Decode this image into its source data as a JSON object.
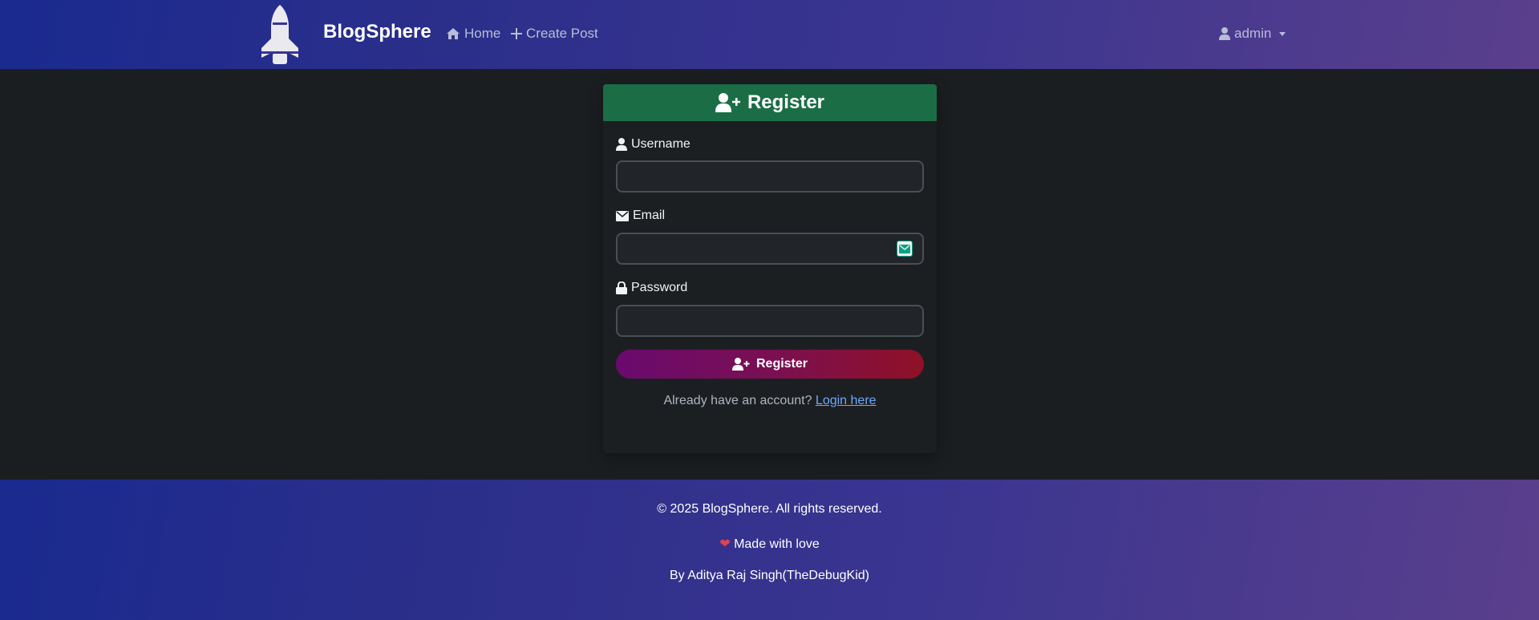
{
  "navbar": {
    "brand": "BlogSphere",
    "home_label": "Home",
    "create_label": "Create Post",
    "user_label": "admin"
  },
  "card": {
    "title": "Register",
    "username_label": "Username",
    "email_label": "Email",
    "password_label": "Password",
    "username_value": "",
    "email_value": "",
    "password_value": "",
    "submit_label": "Register",
    "login_prompt": "Already have an account?",
    "login_link": "Login here"
  },
  "footer": {
    "copyright": "© 2025 BlogSphere. All rights reserved.",
    "made_with": "Made with love",
    "author": "By Aditya Raj Singh(TheDebugKid)"
  },
  "icons": {
    "logo": "rocket-icon",
    "home": "home-icon",
    "create": "plus-icon",
    "user": "user-icon",
    "register": "user-plus-icon",
    "email": "envelope-icon",
    "password": "lock-icon",
    "heart": "heart-icon"
  },
  "colors": {
    "header_green": "#1b6d45",
    "button_gradient_start": "#6a0a6e",
    "button_gradient_end": "#8f1126",
    "link": "#6ea8fe",
    "heart": "#e0424e"
  }
}
